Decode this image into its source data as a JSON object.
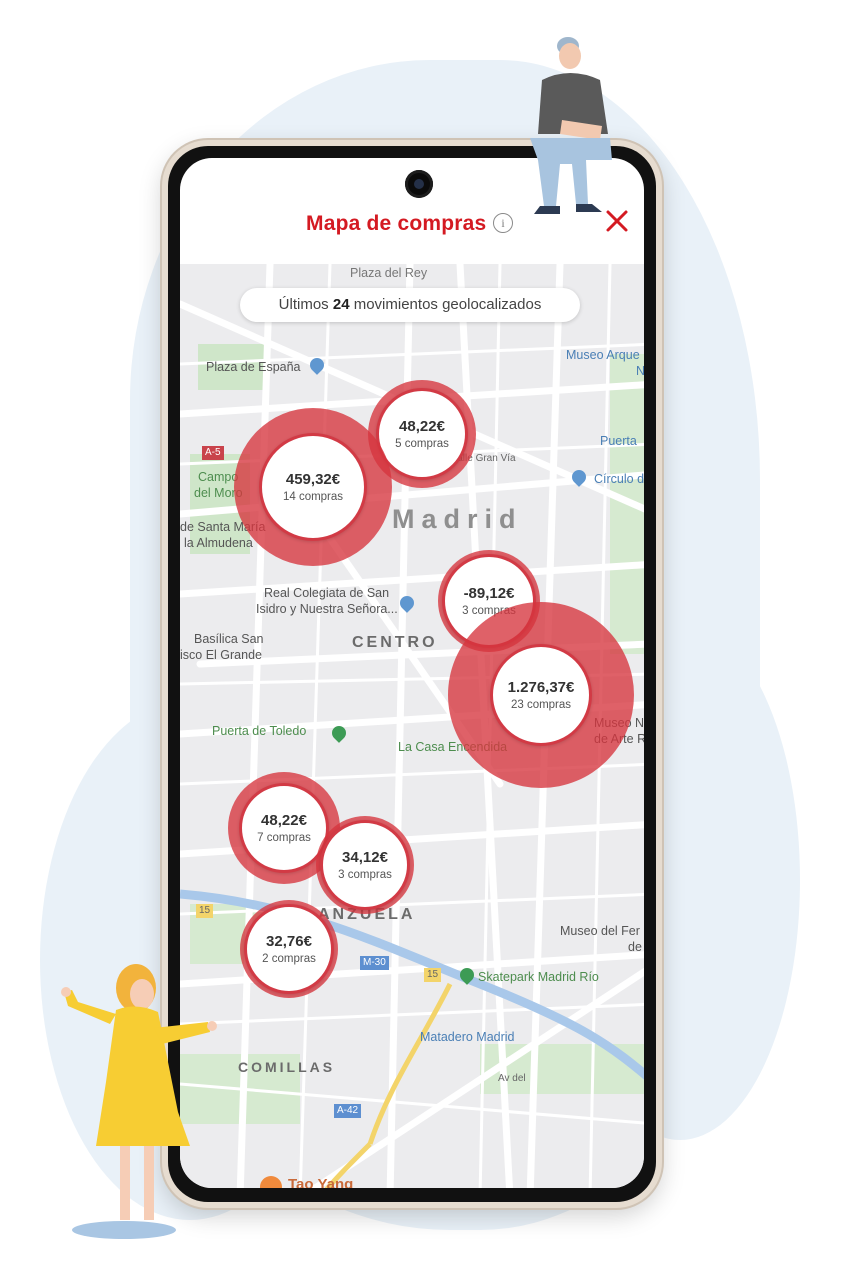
{
  "app": {
    "title": "Mapa de compras",
    "info_icon": "info-icon",
    "close_icon": "close-icon",
    "accent_color": "#d41a22"
  },
  "summary": {
    "prefix": "Últimos",
    "count": "24",
    "suffix": "movimientos geolocalizados"
  },
  "map_labels": {
    "top_cut": "Plaza del Rey",
    "plaza_espana": "Plaza de España",
    "museo_arq": "Museo Arque",
    "museo_arq_2": "N",
    "puerta": "Puerta",
    "circulo": "Círculo d",
    "calle_gran_via": "Calle Gran Vía",
    "a5": "A-5",
    "campo_del_moro_1": "Campo",
    "campo_del_moro_2": "del Moro",
    "almudena_1": "de Santa María",
    "almudena_2": "la Almudena",
    "madrid": "Madrid",
    "real_colegiata_1": "Real Colegiata de San",
    "real_colegiata_2": "Isidro y Nuestra Señora...",
    "centro": "CENTRO",
    "basilica_1": "Basílica San",
    "basilica_2": "isco El Grande",
    "puerta_toledo": "Puerta de Toledo",
    "casa_encendida": "La Casa Encendida",
    "museo_nac_1": "Museo N",
    "museo_nac_2": "de Arte R",
    "arganzuela": "ANZUELA",
    "museo_fer_1": "Museo del Fer",
    "museo_fer_2": "de",
    "m30": "M-30",
    "road_15a": "15",
    "road_15b": "15",
    "skatepark": "Skatepark Madrid Río",
    "matadero": "Matadero Madrid",
    "comillas": "COMILLAS",
    "av_del": "Av del",
    "a42": "A-42",
    "restaurant": "Tao Yang"
  },
  "purchases": [
    {
      "amount": "48,22€",
      "count": "5 compras"
    },
    {
      "amount": "459,32€",
      "count": "14 compras"
    },
    {
      "amount": "-89,12€",
      "count": "3 compras"
    },
    {
      "amount": "1.276,37€",
      "count": "23 compras"
    },
    {
      "amount": "48,22€",
      "count": "7 compras"
    },
    {
      "amount": "34,12€",
      "count": "3 compras"
    },
    {
      "amount": "32,76€",
      "count": "2 compras"
    }
  ]
}
